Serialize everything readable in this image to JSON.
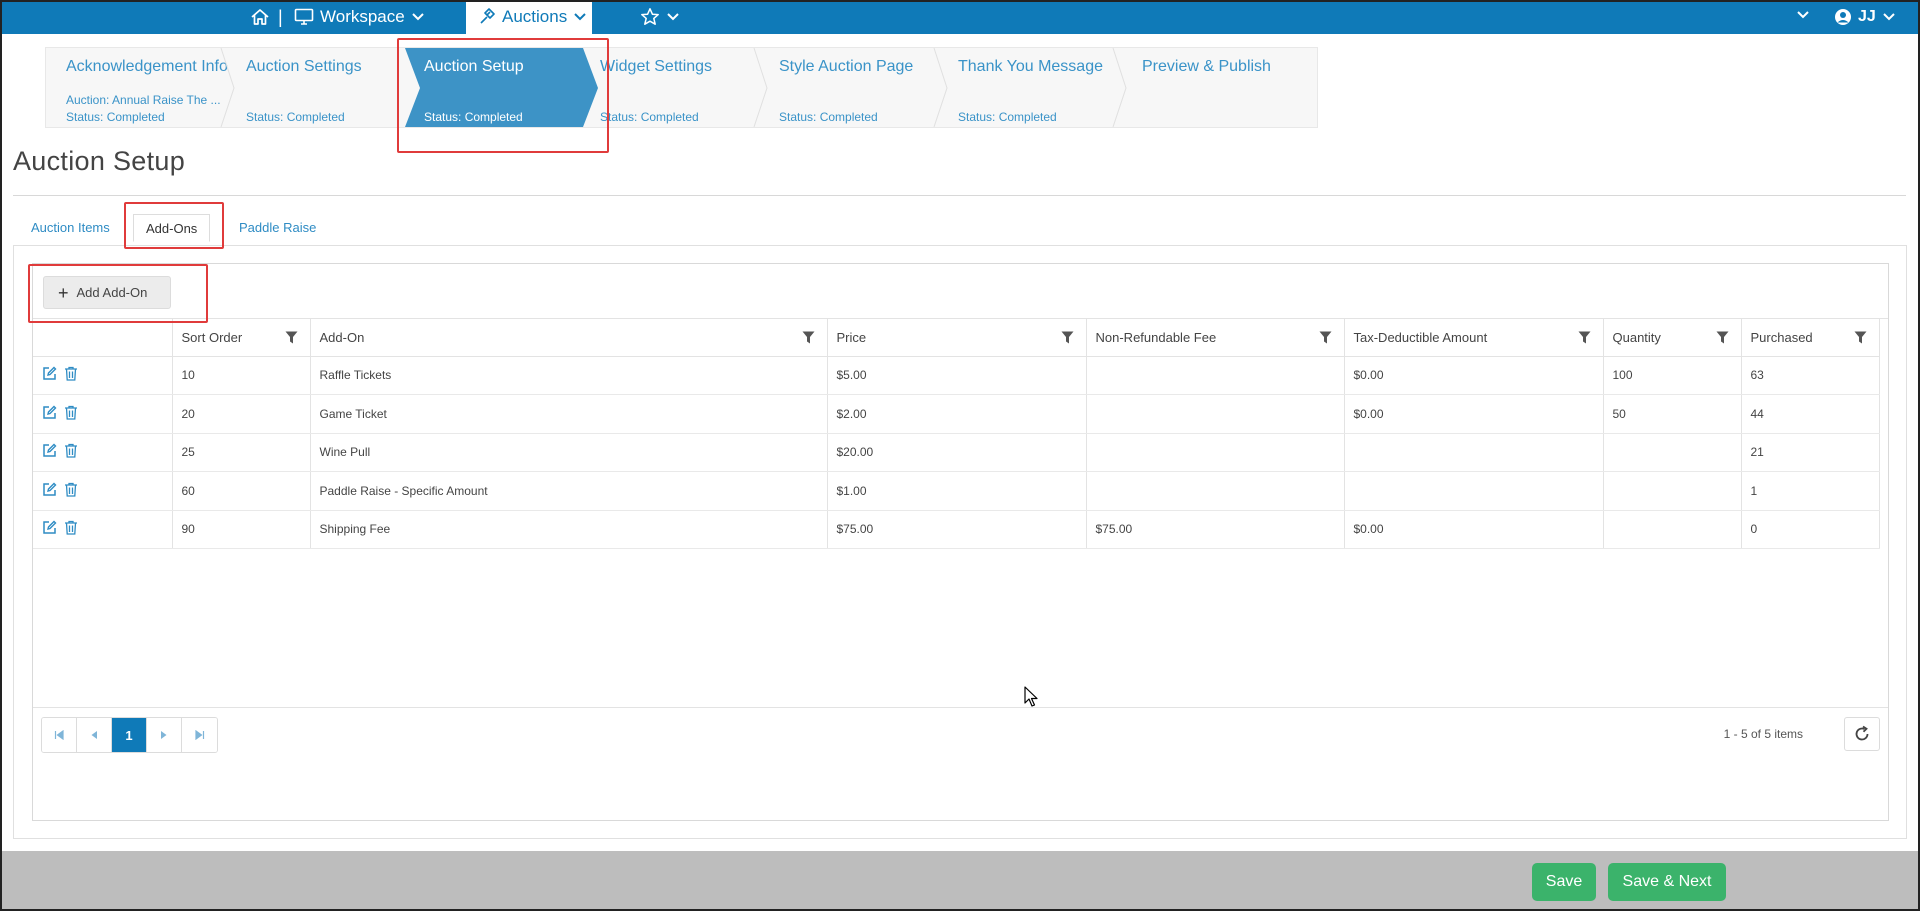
{
  "topnav": {
    "workspace_label": "Workspace",
    "auctions_label": "Auctions",
    "user_initials": "JJ",
    "pipe": "|"
  },
  "steps": [
    {
      "title": "Acknowledgement Info",
      "sub1": "Auction: Annual Raise The ...",
      "status": "Status: Completed"
    },
    {
      "title": "Auction Settings",
      "status": "Status: Completed"
    },
    {
      "title": "Auction Setup",
      "status": "Status: Completed",
      "active": true
    },
    {
      "title": "Widget Settings",
      "status": "Status: Completed"
    },
    {
      "title": "Style Auction Page",
      "status": "Status: Completed"
    },
    {
      "title": "Thank You Message",
      "status": "Status: Completed"
    },
    {
      "title": "Preview & Publish"
    }
  ],
  "page_title": "Auction Setup",
  "tabs": [
    {
      "label": "Auction Items"
    },
    {
      "label": "Add-Ons",
      "active": true
    },
    {
      "label": "Paddle Raise"
    }
  ],
  "grid": {
    "add_button_label": "Add Add-On",
    "columns": [
      "",
      "Sort Order",
      "Add-On",
      "Price",
      "Non-Refundable Fee",
      "Tax-Deductible Amount",
      "Quantity",
      "Purchased"
    ],
    "rows": [
      [
        "10",
        "Raffle Tickets",
        "$5.00",
        "",
        "$0.00",
        "100",
        "63"
      ],
      [
        "20",
        "Game Ticket",
        "$2.00",
        "",
        "$0.00",
        "50",
        "44"
      ],
      [
        "25",
        "Wine Pull",
        "$20.00",
        "",
        "",
        "",
        "21"
      ],
      [
        "60",
        "Paddle Raise - Specific Amount",
        "$1.00",
        "",
        "",
        "",
        "1"
      ],
      [
        "90",
        "Shipping Fee",
        "$75.00",
        "$75.00",
        "$0.00",
        "",
        "0"
      ]
    ],
    "current_page": "1",
    "pager_info": "1 - 5 of 5 items"
  },
  "footer": {
    "save_label": "Save",
    "save_next_label": "Save & Next"
  },
  "colors": {
    "nav_blue": "#0f7ab8",
    "active_step": "#3d93c6",
    "green": "#3bb36b",
    "highlight": "#e03b3b"
  }
}
